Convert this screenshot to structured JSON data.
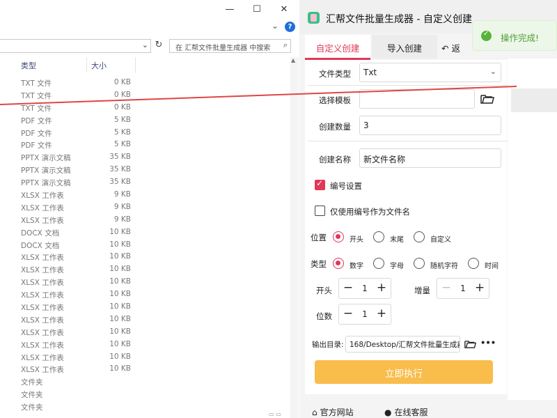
{
  "explorer": {
    "search_placeholder": "在 汇帮文件批量生成器 中搜索",
    "columns": {
      "type": "类型",
      "size": "大小"
    },
    "window_controls": {
      "minimize": "—",
      "maximize": "☐",
      "close": "✕"
    },
    "rows": [
      {
        "type": "TXT 文件",
        "size": "0 KB"
      },
      {
        "type": "TXT 文件",
        "size": "0 KB"
      },
      {
        "type": "TXT 文件",
        "size": "0 KB"
      },
      {
        "type": "PDF 文件",
        "size": "5 KB"
      },
      {
        "type": "PDF 文件",
        "size": "5 KB"
      },
      {
        "type": "PDF 文件",
        "size": "5 KB"
      },
      {
        "type": "PPTX 演示文稿",
        "size": "35 KB"
      },
      {
        "type": "PPTX 演示文稿",
        "size": "35 KB"
      },
      {
        "type": "PPTX 演示文稿",
        "size": "35 KB"
      },
      {
        "type": "XLSX 工作表",
        "size": "9 KB"
      },
      {
        "type": "XLSX 工作表",
        "size": "9 KB"
      },
      {
        "type": "XLSX 工作表",
        "size": "9 KB"
      },
      {
        "type": "DOCX 文档",
        "size": "10 KB"
      },
      {
        "type": "DOCX 文档",
        "size": "10 KB"
      },
      {
        "type": "XLSX 工作表",
        "size": "10 KB"
      },
      {
        "type": "XLSX 工作表",
        "size": "10 KB"
      },
      {
        "type": "XLSX 工作表",
        "size": "10 KB"
      },
      {
        "type": "XLSX 工作表",
        "size": "10 KB"
      },
      {
        "type": "XLSX 工作表",
        "size": "10 KB"
      },
      {
        "type": "XLSX 工作表",
        "size": "10 KB"
      },
      {
        "type": "XLSX 工作表",
        "size": "10 KB"
      },
      {
        "type": "XLSX 工作表",
        "size": "10 KB"
      },
      {
        "type": "XLSX 工作表",
        "size": "10 KB"
      },
      {
        "type": "XLSX 工作表",
        "size": "10 KB"
      },
      {
        "type": "文件夹",
        "size": ""
      },
      {
        "type": "文件夹",
        "size": ""
      },
      {
        "type": "文件夹",
        "size": ""
      }
    ]
  },
  "generator": {
    "title": "汇帮文件批量生成器 - 自定义创建",
    "tabs": {
      "custom": "自定义创建",
      "import": "导入创建",
      "back": "返"
    },
    "form": {
      "file_type_label": "文件类型",
      "file_type_value": "Txt",
      "template_label": "选择模板",
      "template_value": "",
      "count_label": "创建数量",
      "count_value": "3",
      "name_label": "创建名称",
      "name_value": "新文件名称",
      "numbering_label": "编号设置",
      "numbering_checked": true,
      "use_number_only_label": "仅使用编号作为文件名",
      "use_number_only_checked": false,
      "position_label": "位置",
      "position_options": [
        "开头",
        "末尾",
        "自定义"
      ],
      "position_selected": "开头",
      "type_label": "类型",
      "type_options": [
        "数字",
        "字母",
        "随机字符",
        "时间"
      ],
      "type_selected": "数字",
      "start_label": "开头",
      "start_value": "1",
      "increment_label": "增量",
      "increment_value": "1",
      "digits_label": "位数",
      "digits_value": "1",
      "output_label": "输出目录:",
      "output_value": "168/Desktop/汇帮文件批量生成器",
      "more_label": "•••",
      "run_label": "立即执行"
    },
    "footer": {
      "website": "官方网站",
      "support": "在线客服"
    },
    "toast": "操作完成!"
  },
  "colors": {
    "accent": "#e0375a",
    "run_button": "#f9bd4c",
    "success": "#58b33c",
    "arrow_line": "#e04545"
  }
}
